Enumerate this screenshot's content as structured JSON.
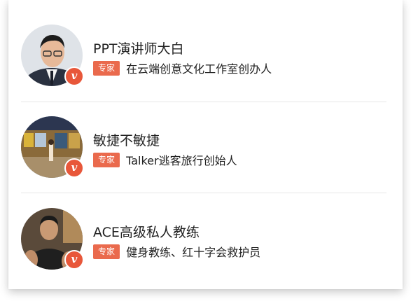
{
  "experts": [
    {
      "name": "PPT演讲师大白",
      "tag": "专家",
      "description": "在云端创意文化工作室创办人",
      "badge": "v"
    },
    {
      "name": "敏捷不敏捷",
      "tag": "专家",
      "description": "Talker逃客旅行创始人",
      "badge": "v"
    },
    {
      "name": "ACE高级私人教练",
      "tag": "专家",
      "description": "健身教练、红十字会救护员",
      "badge": "v"
    }
  ],
  "colors": {
    "accent": "#ea6a4d",
    "badge": "#e8573a"
  }
}
